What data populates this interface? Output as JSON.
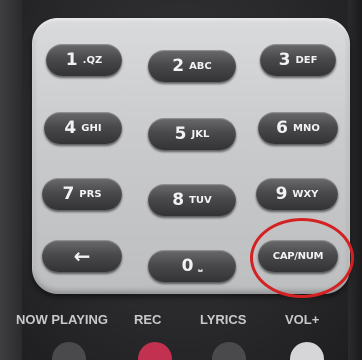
{
  "keypad": {
    "k1": {
      "digit": "1",
      "letters": ".QZ"
    },
    "k2": {
      "digit": "2",
      "letters": "ABC"
    },
    "k3": {
      "digit": "3",
      "letters": "DEF"
    },
    "k4": {
      "digit": "4",
      "letters": "GHI"
    },
    "k5": {
      "digit": "5",
      "letters": "JKL"
    },
    "k6": {
      "digit": "6",
      "letters": "MNO"
    },
    "k7": {
      "digit": "7",
      "letters": "PRS"
    },
    "k8": {
      "digit": "8",
      "letters": "TUV"
    },
    "k9": {
      "digit": "9",
      "letters": "WXY"
    },
    "back": {
      "symbol": "←"
    },
    "k0": {
      "digit": "0",
      "letters": "⎵"
    },
    "capnum": {
      "label": "CAP/NUM"
    }
  },
  "bottom_row": {
    "now_playing": "NOW PLAYING",
    "rec": "REC",
    "lyrics": "LYRICS",
    "vol_plus": "VOL+"
  },
  "colors": {
    "highlight_circle": "#d42121",
    "rec_button": "#c2314f"
  }
}
